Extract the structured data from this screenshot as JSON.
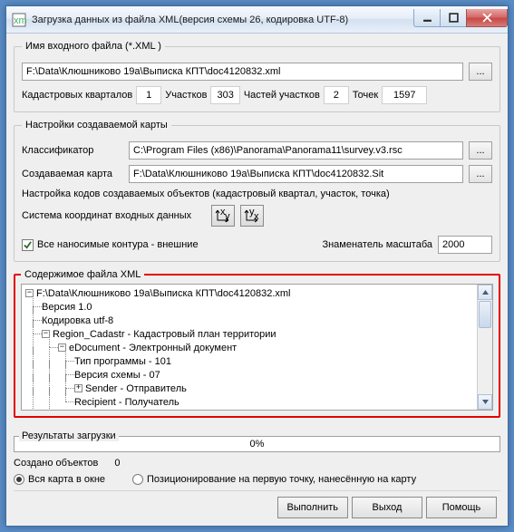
{
  "window": {
    "title": "Загрузка данных из файла XML(версия схемы 26, кодировка UTF-8)"
  },
  "input_file": {
    "legend": "Имя входного файла (*.XML )",
    "path": "F:\\Data\\Клюшниково 19а\\Выписка КПТ\\doc4120832.xml",
    "stats": {
      "kvartals_label": "Кадастровых кварталов",
      "kvartals": "1",
      "parcels_label": "Участков",
      "parcels": "303",
      "parts_label": "Частей участков",
      "parts": "2",
      "points_label": "Точек",
      "points": "1597"
    }
  },
  "map_settings": {
    "legend": "Настройки создаваемой карты",
    "classifier_label": "Классификатор",
    "classifier": "C:\\Program Files (x86)\\Panorama\\Panorama11\\survey.v3.rsc",
    "created_map_label": "Создаваемая карта",
    "created_map": "F:\\Data\\Клюшниково 19а\\Выписка КПТ\\doc4120832.Sit",
    "codes_hint": "Настройка кодов создаваемых объектов (кадастровый квартал, участок, точка)",
    "crs_label": "Система координат входных данных",
    "outer_contours_label": "Все наносимые контура - внешние",
    "scale_label": "Знаменатель масштаба",
    "scale": "2000"
  },
  "xml_contents": {
    "legend": "Содержимое файла XML",
    "tree": {
      "root": "F:\\Data\\Клюшниково 19а\\Выписка КПТ\\doc4120832.xml",
      "version": "Версия 1.0",
      "encoding": "Кодировка utf-8",
      "region": "Region_Cadastr - Кадастровый план территории",
      "edoc": "eDocument - Электронный документ",
      "ptype": "Тип программы - 101",
      "schemaver": "Версия схемы - 07",
      "sender": "Sender - Отправитель",
      "recipient": "Recipient - Получатель"
    }
  },
  "results": {
    "legend": "Результаты загрузки",
    "progress": "0%",
    "created_label": "Создано объектов",
    "created": "0",
    "opt_full": "Вся карта в окне",
    "opt_pos": "Позиционирование на первую точку, нанесённую на  карту"
  },
  "buttons": {
    "run": "Выполнить",
    "exit": "Выход",
    "help": "Помощь",
    "dots": "..."
  }
}
